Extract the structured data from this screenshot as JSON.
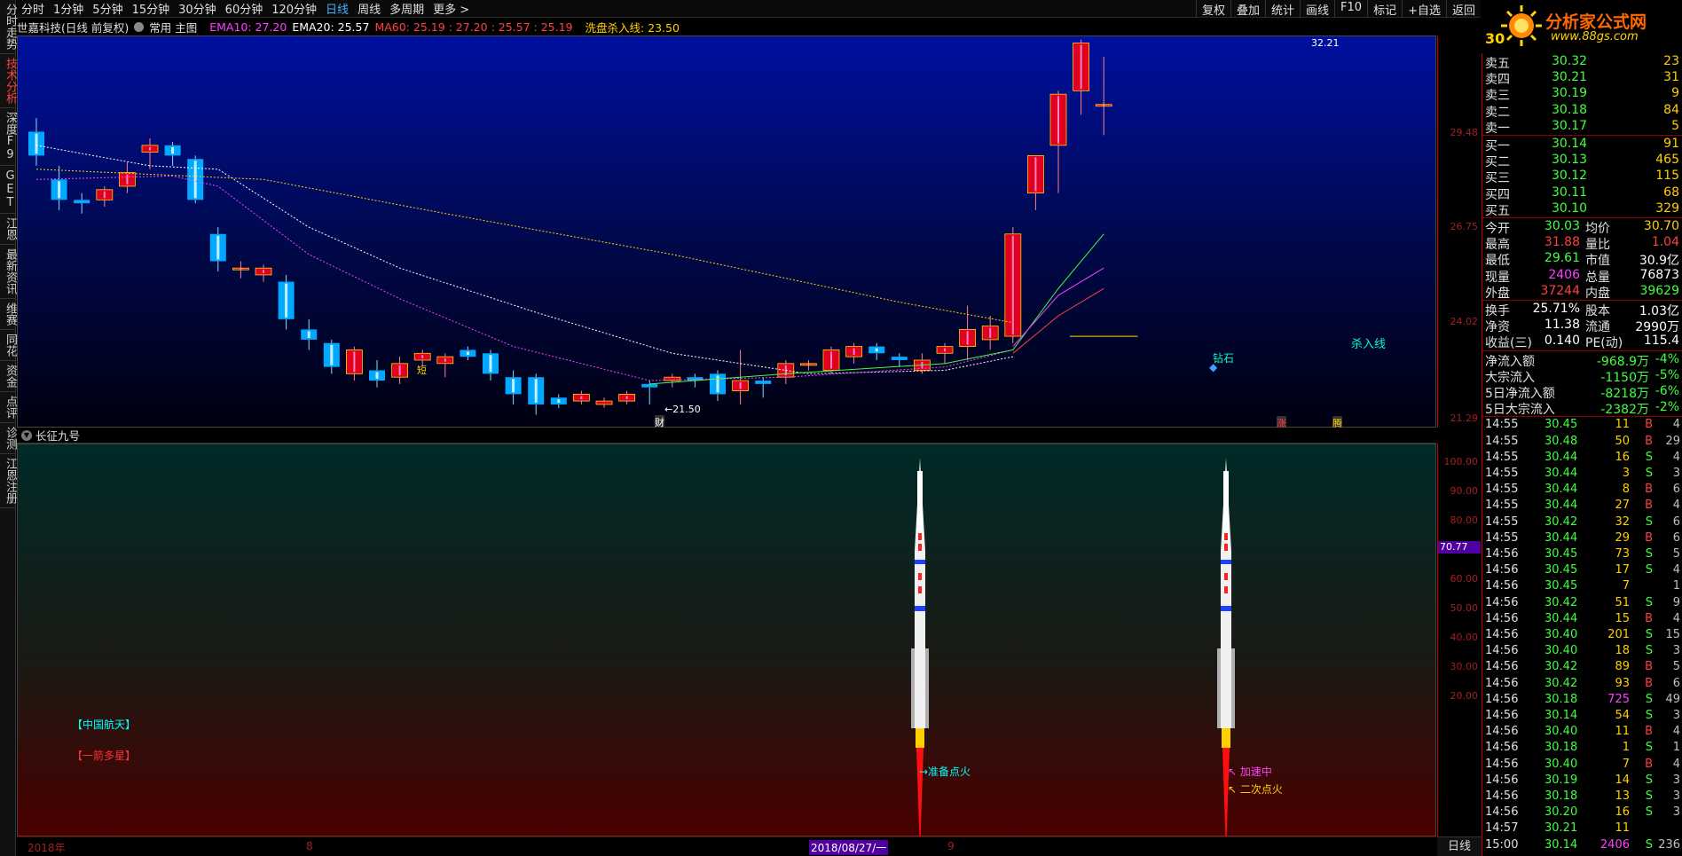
{
  "left_nav": [
    "分时走势",
    "技术分析",
    "深度F9",
    "GET",
    "江恩",
    "最新资讯",
    "维赛",
    "同花",
    "资金",
    "点评",
    "诊测",
    "江恩注册"
  ],
  "toolbar": {
    "periods": [
      "分时",
      "1分钟",
      "5分钟",
      "15分钟",
      "30分钟",
      "60分钟",
      "120分钟",
      "日线",
      "周线",
      "多周期",
      "更多 >"
    ],
    "active_period": "日线",
    "tools": [
      "复权",
      "叠加",
      "统计",
      "画线",
      "F10",
      "标记",
      "+自选",
      "返回"
    ]
  },
  "logo": {
    "title": "分析家公式网",
    "url_text": "www.88gs.com"
  },
  "info": {
    "stock": "世嘉科技(日线 前复权)",
    "template": "常用 主图",
    "ema10": "EMA10: 27.20",
    "ema20": "EMA20: 25.57",
    "ma60": "MA60: 25.19 : 27.20 : 25.57 : 25.19",
    "xipan": "洗盘杀入线: 23.50"
  },
  "y_axis_top": [
    "29.48",
    "26.75",
    "24.02",
    "21.29"
  ],
  "y_axis_bottom": [
    "100.00",
    "90.00",
    "80.00",
    "70.00",
    "60.00",
    "50.00",
    "40.00",
    "30.00",
    "20.00"
  ],
  "current_indicator_value": "70.77",
  "chart_labels": {
    "high": "32.21",
    "low": "←21.50",
    "cai": "财",
    "duan": "短",
    "zuanshi": "钻石",
    "sharuxian": "杀入线",
    "zhang": "涨",
    "teng": "腾"
  },
  "indicator": {
    "name": "长征九号",
    "tag1": "【中国航天】",
    "tag2": "【一箭多星】",
    "rocket1_label": "→准备点火",
    "rocket2_label1": "↖ 加速中",
    "rocket2_label2": "↖ 二次点火"
  },
  "time_axis": {
    "year": "2018年",
    "m8": "8",
    "cursor": "2018/08/27/一",
    "m9": "9"
  },
  "period_button": "日线",
  "quote": {
    "code": "30",
    "sells": [
      {
        "label": "卖五",
        "price": "30.32",
        "vol": "23"
      },
      {
        "label": "卖四",
        "price": "30.21",
        "vol": "31"
      },
      {
        "label": "卖三",
        "price": "30.19",
        "vol": "9"
      },
      {
        "label": "卖二",
        "price": "30.18",
        "vol": "84"
      },
      {
        "label": "卖一",
        "price": "30.17",
        "vol": "5"
      }
    ],
    "buys": [
      {
        "label": "买一",
        "price": "30.14",
        "vol": "91"
      },
      {
        "label": "买二",
        "price": "30.13",
        "vol": "465"
      },
      {
        "label": "买三",
        "price": "30.12",
        "vol": "115"
      },
      {
        "label": "买四",
        "price": "30.11",
        "vol": "68"
      },
      {
        "label": "买五",
        "price": "30.10",
        "vol": "329"
      }
    ],
    "stats": [
      {
        "l1": "今开",
        "v1": "30.03",
        "l2": "均价",
        "v2": "30.70"
      },
      {
        "l1": "最高",
        "v1": "31.88",
        "l2": "量比",
        "v2": "1.04"
      },
      {
        "l1": "最低",
        "v1": "29.61",
        "l2": "市值",
        "v2": "30.9亿"
      },
      {
        "l1": "现量",
        "v1": "2406",
        "l2": "总量",
        "v2": "76873"
      },
      {
        "l1": "外盘",
        "v1": "37244",
        "l2": "内盘",
        "v2": "39629"
      },
      {
        "l1": "换手",
        "v1": "25.71%",
        "l2": "股本",
        "v2": "1.03亿"
      },
      {
        "l1": "净资",
        "v1": "11.38",
        "l2": "流通",
        "v2": "2990万"
      },
      {
        "l1": "收益(三)",
        "v1": "0.140",
        "l2": "PE(动)",
        "v2": "115.4"
      }
    ],
    "flows": [
      {
        "label": "净流入额",
        "value": "-968.9万",
        "pct": "-4%"
      },
      {
        "label": "大宗流入",
        "value": "-1150万",
        "pct": "-5%"
      },
      {
        "label": "5日净流入额",
        "value": "-8218万",
        "pct": "-6%"
      },
      {
        "label": "5日大宗流入",
        "value": "-2382万",
        "pct": "-2%"
      }
    ],
    "ticks": [
      {
        "t": "14:55",
        "p": "30.45",
        "v": "11",
        "s": "B",
        "n": "4"
      },
      {
        "t": "14:55",
        "p": "30.48",
        "v": "50",
        "s": "B",
        "n": "29"
      },
      {
        "t": "14:55",
        "p": "30.44",
        "v": "16",
        "s": "S",
        "n": "4"
      },
      {
        "t": "14:55",
        "p": "30.44",
        "v": "3",
        "s": "S",
        "n": "3"
      },
      {
        "t": "14:55",
        "p": "30.44",
        "v": "8",
        "s": "B",
        "n": "6"
      },
      {
        "t": "14:55",
        "p": "30.44",
        "v": "27",
        "s": "B",
        "n": "4"
      },
      {
        "t": "14:55",
        "p": "30.42",
        "v": "32",
        "s": "S",
        "n": "6"
      },
      {
        "t": "14:55",
        "p": "30.44",
        "v": "29",
        "s": "B",
        "n": "6"
      },
      {
        "t": "14:56",
        "p": "30.45",
        "v": "73",
        "s": "S",
        "n": "5"
      },
      {
        "t": "14:56",
        "p": "30.45",
        "v": "17",
        "s": "S",
        "n": "4"
      },
      {
        "t": "14:56",
        "p": "30.45",
        "v": "7",
        "s": "",
        "n": "1"
      },
      {
        "t": "14:56",
        "p": "30.42",
        "v": "51",
        "s": "S",
        "n": "9"
      },
      {
        "t": "14:56",
        "p": "30.44",
        "v": "15",
        "s": "B",
        "n": "4"
      },
      {
        "t": "14:56",
        "p": "30.40",
        "v": "201",
        "s": "S",
        "n": "15"
      },
      {
        "t": "14:56",
        "p": "30.40",
        "v": "18",
        "s": "S",
        "n": "3"
      },
      {
        "t": "14:56",
        "p": "30.42",
        "v": "89",
        "s": "B",
        "n": "5"
      },
      {
        "t": "14:56",
        "p": "30.42",
        "v": "93",
        "s": "B",
        "n": "6"
      },
      {
        "t": "14:56",
        "p": "30.18",
        "v": "725",
        "s": "S",
        "n": "49"
      },
      {
        "t": "14:56",
        "p": "30.14",
        "v": "54",
        "s": "S",
        "n": "3"
      },
      {
        "t": "14:56",
        "p": "30.40",
        "v": "11",
        "s": "B",
        "n": "4"
      },
      {
        "t": "14:56",
        "p": "30.18",
        "v": "1",
        "s": "S",
        "n": "1"
      },
      {
        "t": "14:56",
        "p": "30.40",
        "v": "7",
        "s": "B",
        "n": "4"
      },
      {
        "t": "14:56",
        "p": "30.19",
        "v": "14",
        "s": "S",
        "n": "3"
      },
      {
        "t": "14:56",
        "p": "30.18",
        "v": "13",
        "s": "S",
        "n": "3"
      },
      {
        "t": "14:56",
        "p": "30.20",
        "v": "16",
        "s": "S",
        "n": "3"
      },
      {
        "t": "14:57",
        "p": "30.21",
        "v": "11",
        "s": "",
        "n": ""
      },
      {
        "t": "15:00",
        "p": "30.14",
        "v": "2406",
        "s": "S",
        "n": "236"
      }
    ]
  },
  "colors": {
    "up": "#ff2020",
    "down": "#00c8ff",
    "ema10": "#ffffff",
    "ema20": "#ff00ff",
    "ma60": "#ffd000",
    "accent": "#3cb4ff"
  }
}
